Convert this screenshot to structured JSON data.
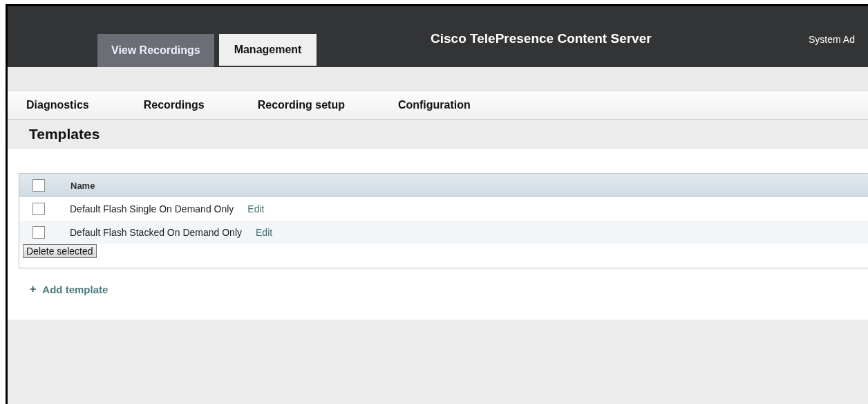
{
  "header": {
    "tabs": [
      {
        "label": "View Recordings",
        "selected": false
      },
      {
        "label": "Management",
        "selected": true
      }
    ],
    "title": "Cisco TelePresence Content Server",
    "user": "System Ad"
  },
  "nav": {
    "items": [
      "Diagnostics",
      "Recordings",
      "Recording setup",
      "Configuration"
    ]
  },
  "page_title": "Templates",
  "table": {
    "select_all": {
      "checked": false
    },
    "columns": [
      "Name"
    ],
    "rows": [
      {
        "checked": false,
        "name": "Default Flash Single On Demand Only",
        "action": "Edit"
      },
      {
        "checked": false,
        "name": "Default Flash Stacked On Demand Only",
        "action": "Edit"
      }
    ],
    "delete_button": "Delete selected"
  },
  "add_link": {
    "icon": "+",
    "label": "Add template"
  }
}
